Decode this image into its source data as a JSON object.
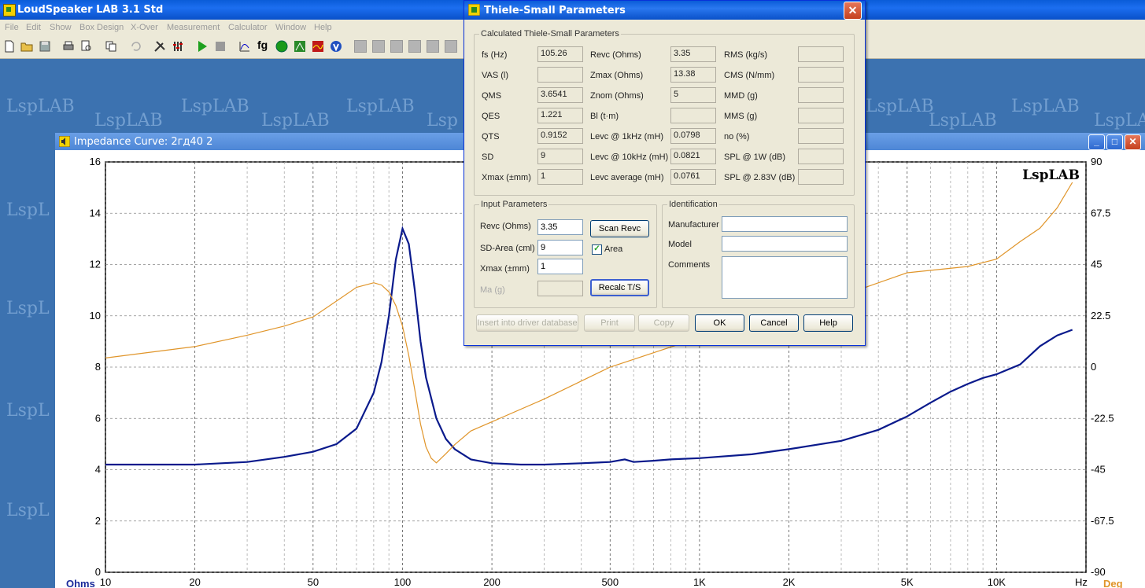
{
  "app": {
    "title": "LoudSpeaker LAB 3.1 Std",
    "menu": [
      "File",
      "Edit",
      "Show",
      "Box Design",
      "X-Over",
      "Measurement",
      "Calculator",
      "Window",
      "Help"
    ],
    "watermark": "LspLAB",
    "watermark_partial": "LspL",
    "watermark_cut": "Lsp"
  },
  "child_window": {
    "title": "Impedance Curve: 2гд40 2",
    "plot_watermark": "LspLAB"
  },
  "chart_data": {
    "type": "line",
    "xlabel": "Hz",
    "ylabel_left": "Ohms",
    "ylabel_right": "Deg",
    "x_scale": "log",
    "xlim": [
      10,
      20000
    ],
    "ylim_left": [
      0,
      16
    ],
    "ylim_right": [
      -90,
      90
    ],
    "x_tick_labels": [
      "10",
      "20",
      "50",
      "100",
      "200",
      "500",
      "1K",
      "2K",
      "5K",
      "10K"
    ],
    "x_ticks": [
      10,
      20,
      50,
      100,
      200,
      500,
      1000,
      2000,
      5000,
      10000
    ],
    "y_left_ticks": [
      0,
      2,
      4,
      6,
      8,
      10,
      12,
      14,
      16
    ],
    "y_right_ticks": [
      "90",
      "67.5",
      "45",
      "22.5",
      "0",
      "-22.5",
      "-45",
      "-67.5",
      "-90"
    ],
    "grid": true,
    "series": [
      {
        "axis": "left",
        "color": "#0a1a8c",
        "x": [
          10,
          20,
          30,
          40,
          50,
          60,
          70,
          80,
          85,
          90,
          95,
          100,
          105,
          110,
          115,
          120,
          130,
          140,
          150,
          170,
          200,
          250,
          300,
          400,
          500,
          560,
          600,
          700,
          800,
          1000,
          1500,
          2000,
          3000,
          4000,
          5000,
          6000,
          7000,
          8000,
          9000,
          10000,
          12000,
          14000,
          16000,
          18000
        ],
        "y": [
          4.2,
          4.2,
          4.3,
          4.5,
          4.7,
          5.0,
          5.6,
          7.0,
          8.2,
          10.0,
          12.2,
          13.4,
          12.8,
          11.0,
          9.0,
          7.6,
          6.0,
          5.2,
          4.8,
          4.4,
          4.25,
          4.2,
          4.2,
          4.25,
          4.3,
          4.4,
          4.3,
          4.35,
          4.4,
          4.45,
          4.6,
          4.8,
          5.2,
          5.6,
          6.0,
          6.4,
          6.8,
          7.2,
          7.6,
          7.9,
          8.3,
          8.7,
          9.0,
          9.5
        ]
      },
      {
        "axis": "right",
        "color": "#e0952a",
        "x": [
          10,
          20,
          30,
          40,
          50,
          60,
          70,
          80,
          85,
          90,
          95,
          100,
          105,
          110,
          115,
          120,
          125,
          130,
          140,
          150,
          170,
          200,
          300,
          500,
          1000,
          1500,
          2000,
          3000,
          5000,
          8000,
          10000,
          12000,
          14000,
          16000,
          18000
        ],
        "y": [
          4,
          9,
          14,
          18,
          22,
          29,
          35,
          37,
          36,
          33,
          27,
          18,
          5,
          -10,
          -25,
          -35,
          -40,
          -42,
          -38,
          -34,
          -28,
          -24,
          -14,
          0,
          13,
          20,
          25,
          31,
          39,
          46,
          50,
          54,
          58,
          70,
          84
        ]
      }
    ]
  },
  "dialog": {
    "title": "Thiele-Small Parameters",
    "calc_group_title": "Calculated Thiele-Small Parameters",
    "calc": {
      "col1": [
        {
          "label": "fs (Hz)",
          "value": "105.26"
        },
        {
          "label": "VAS (l)",
          "value": ""
        },
        {
          "label": "QMS",
          "value": "3.6541"
        },
        {
          "label": "QES",
          "value": "1.221"
        },
        {
          "label": "QTS",
          "value": "0.9152"
        },
        {
          "label": "SD",
          "value": "9"
        },
        {
          "label": "Xmax (±mm)",
          "value": "1"
        }
      ],
      "col2": [
        {
          "label": "Revc (Ohms)",
          "value": "3.35"
        },
        {
          "label": "Zmax (Ohms)",
          "value": "13.38"
        },
        {
          "label": "Znom (Ohms)",
          "value": "5"
        },
        {
          "label": "Bl (t·m)",
          "value": ""
        },
        {
          "label": "Levc @ 1kHz (mH)",
          "value": "0.0798"
        },
        {
          "label": "Levc @ 10kHz (mH)",
          "value": "0.0821"
        },
        {
          "label": "Levc average (mH)",
          "value": "0.0761"
        }
      ],
      "col3": [
        {
          "label": "RMS (kg/s)",
          "value": ""
        },
        {
          "label": "CMS (N/mm)",
          "value": ""
        },
        {
          "label": "MMD (g)",
          "value": ""
        },
        {
          "label": "MMS (g)",
          "value": ""
        },
        {
          "label": "no (%)",
          "value": ""
        },
        {
          "label": "SPL @ 1W (dB)",
          "value": ""
        },
        {
          "label": "SPL @ 2.83V (dB)",
          "value": ""
        }
      ]
    },
    "input_group_title": "Input Parameters",
    "inputs": [
      {
        "label": "Revc (Ohms)",
        "value": "3.35"
      },
      {
        "label": "SD-Area (cml)",
        "value": "9"
      },
      {
        "label": "Xmax (±mm)",
        "value": "1"
      },
      {
        "label": "Ma (g)",
        "value": ""
      }
    ],
    "scan_revc": "Scan Revc",
    "area_checkbox": "Area",
    "area_checked": true,
    "recalc": "Recalc T/S",
    "ident_group_title": "Identification",
    "ident": {
      "manufacturer_label": "Manufacturer",
      "manufacturer": "",
      "model_label": "Model",
      "model": "",
      "comments_label": "Comments",
      "comments": ""
    },
    "buttons": {
      "insert": "Insert into driver database",
      "print": "Print",
      "copy": "Copy",
      "ok": "OK",
      "cancel": "Cancel",
      "help": "Help"
    }
  }
}
